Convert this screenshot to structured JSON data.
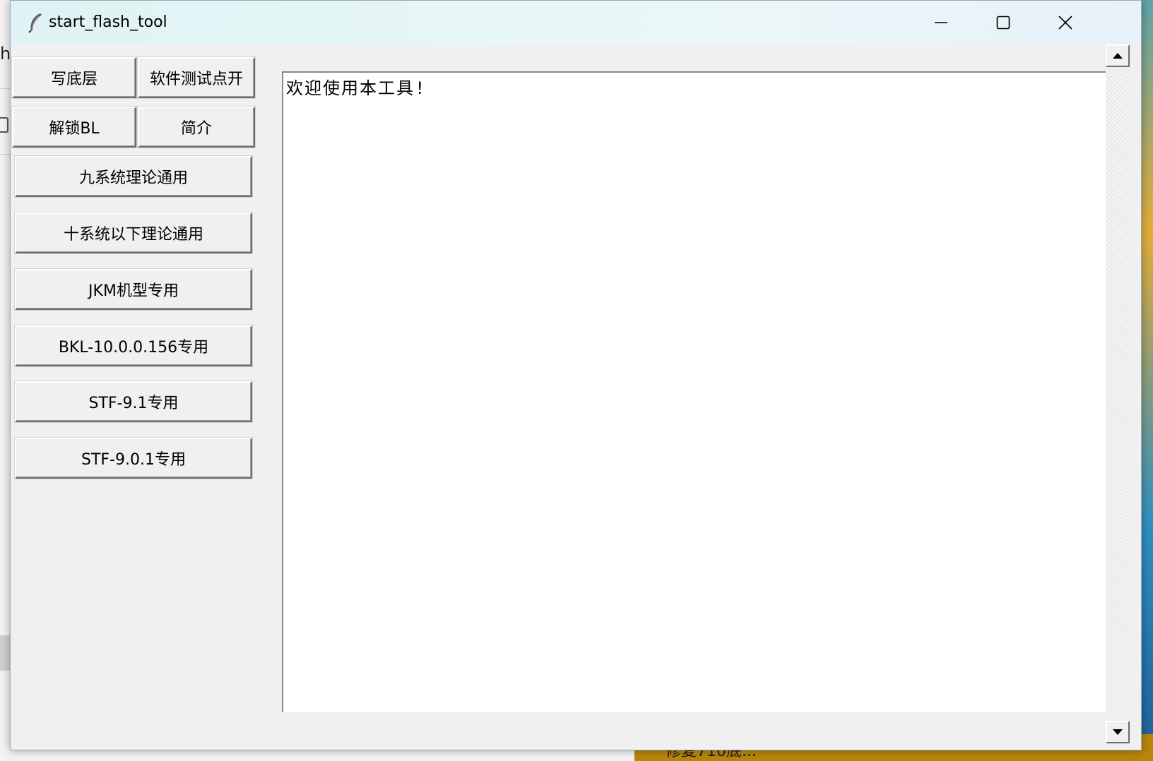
{
  "window": {
    "title": "start_flash_tool"
  },
  "buttons": {
    "write_base": "写底层",
    "software_test_open": "软件测试点开",
    "unlock_bl": "解锁BL",
    "intro": "简介",
    "nine_system_general": "九系统理论通用",
    "ten_below_general": "十系统以下理论通用",
    "jkm_model": "JKM机型专用",
    "bkl_10_0_0_156": "BKL-10.0.0.156专用",
    "stf_9_1": "STF-9.1专用",
    "stf_9_0_1": "STF-9.0.1专用"
  },
  "output": {
    "welcome_text": "欢迎使用本工具!"
  },
  "background": {
    "left_text": "h",
    "bottom_text": "修复710底..."
  },
  "icons": {
    "app": "feather-icon",
    "minimize": "minimize-icon",
    "maximize": "maximize-icon",
    "close": "close-icon",
    "scroll_up": "scroll-up-arrow-icon",
    "scroll_down": "scroll-down-arrow-icon"
  },
  "colors": {
    "titlebar": "#dff3f4",
    "window_bg": "#f0f0f0",
    "text_area_bg": "#ffffff"
  }
}
